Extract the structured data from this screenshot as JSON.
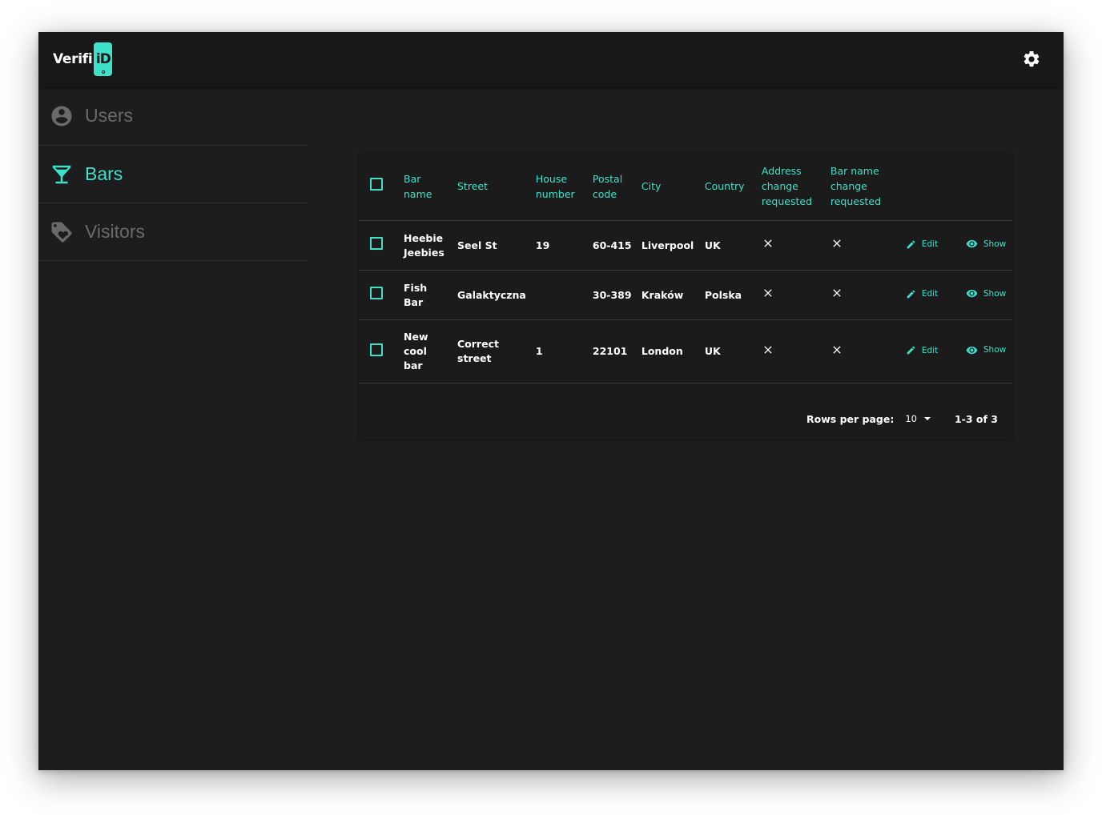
{
  "app": {
    "logo_text": "Verifi",
    "logo_phone_text": "iD"
  },
  "sidebar": {
    "items": [
      {
        "label": "Users",
        "icon": "account-circle-icon",
        "active": false
      },
      {
        "label": "Bars",
        "icon": "cocktail-glass-icon",
        "active": true
      },
      {
        "label": "Visitors",
        "icon": "tags-icon",
        "active": false
      }
    ]
  },
  "table": {
    "headers": {
      "bar_name": "Bar name",
      "street": "Street",
      "house_number": "House number",
      "postal_code": "Postal code",
      "city": "City",
      "country": "Country",
      "address_change": "Address change requested",
      "bar_name_change": "Bar name change requested"
    },
    "rows": [
      {
        "bar_name": "Heebie Jeebies",
        "street": "Seel St",
        "house_number": "19",
        "postal_code": "60-415",
        "city": "Liverpool",
        "country": "UK",
        "edit": "Edit",
        "show": "Show"
      },
      {
        "bar_name": "Fish Bar",
        "street": "Galaktyczna",
        "house_number": "",
        "postal_code": "30-389",
        "city": "Kraków",
        "country": "Polska",
        "edit": "Edit",
        "show": "Show"
      },
      {
        "bar_name": "New cool bar",
        "street": "Correct street",
        "house_number": "1",
        "postal_code": "22101",
        "city": "London",
        "country": "UK",
        "edit": "Edit",
        "show": "Show"
      }
    ]
  },
  "pagination": {
    "rows_per_page_label": "Rows per page:",
    "rows_per_page_value": "10",
    "range": "1-3 of 3"
  },
  "colors": {
    "accent": "#3fe0c8",
    "background": "#1d1d1d",
    "appbar": "#181818"
  }
}
